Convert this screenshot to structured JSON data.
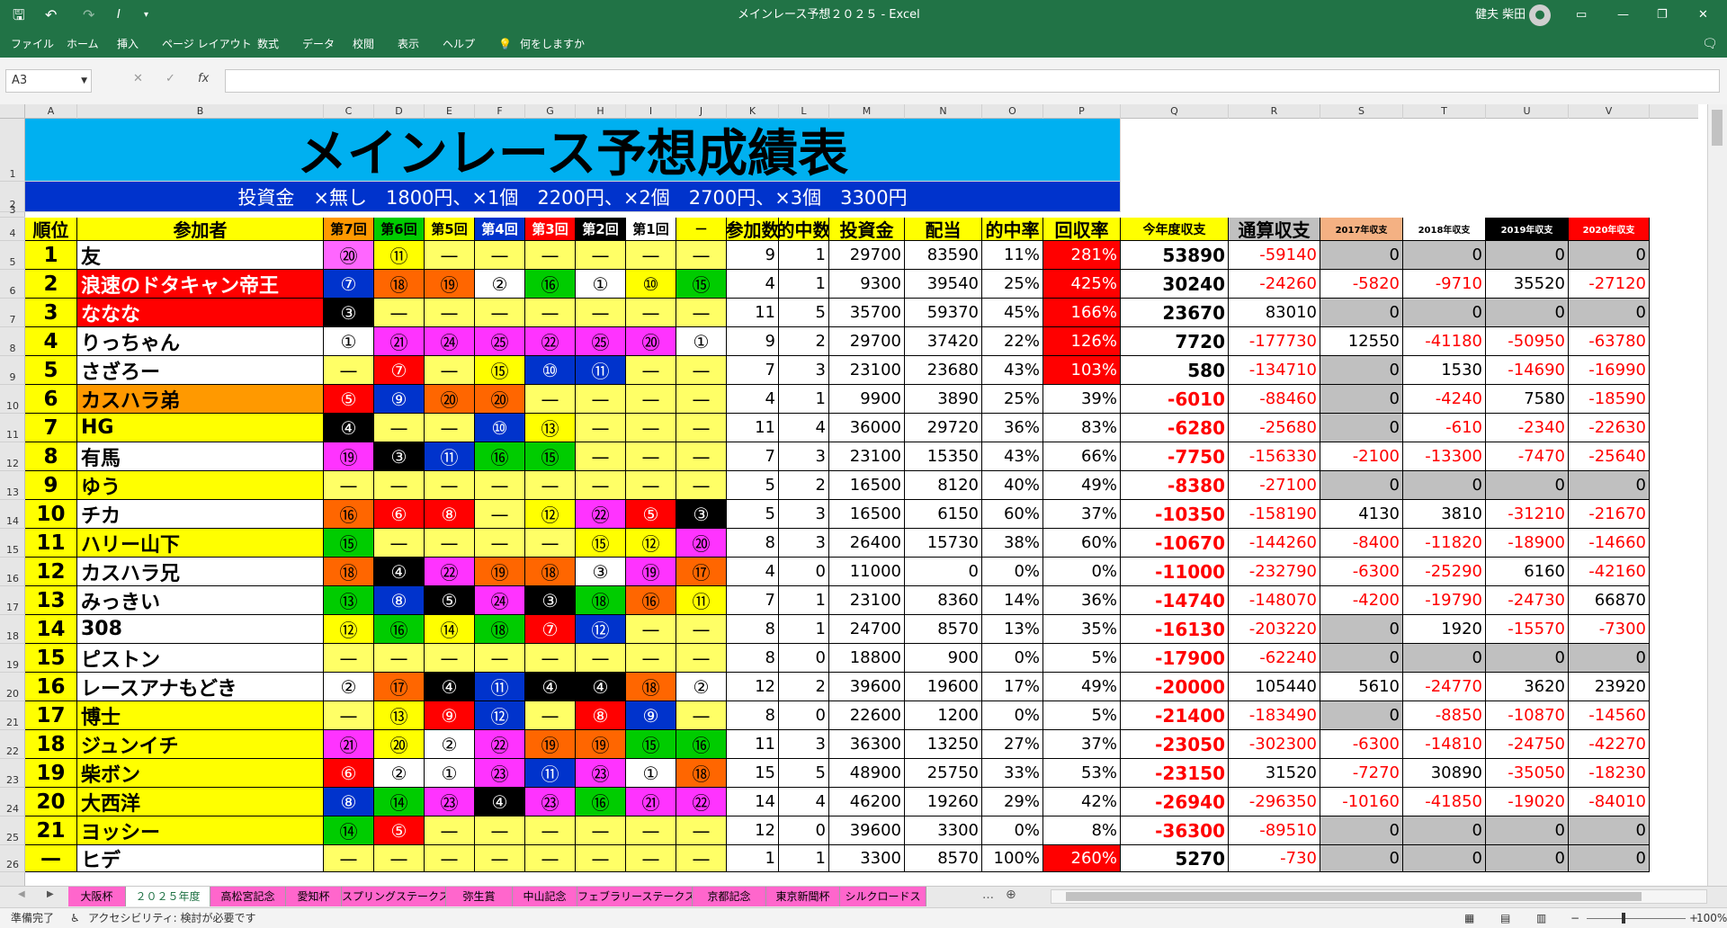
{
  "window": {
    "title": "メインレース予想２０２５ - Excel",
    "user": "健夫 柴田"
  },
  "ribbon": {
    "tabs": [
      "ファイル",
      "ホーム",
      "挿入",
      "ページ レイアウト",
      "数式",
      "データ",
      "校閲",
      "表示",
      "ヘルプ"
    ],
    "tell_me": "何をしますか"
  },
  "formula": {
    "cell_ref": "A3",
    "fx": "fx",
    "value": ""
  },
  "columns": [
    "A",
    "B",
    "C",
    "D",
    "E",
    "F",
    "G",
    "H",
    "I",
    "J",
    "K",
    "L",
    "M",
    "N",
    "O",
    "P",
    "Q",
    "R",
    "S",
    "T",
    "U",
    "V"
  ],
  "row_numbers": [
    "1",
    "2",
    "3",
    "4",
    "5",
    "6",
    "7",
    "8",
    "9",
    "10",
    "11",
    "12",
    "13",
    "14",
    "15",
    "16",
    "17",
    "18",
    "19",
    "20",
    "21",
    "22",
    "23",
    "24",
    "25",
    "26"
  ],
  "sheet": {
    "title": "メインレース予想成績表",
    "subtitle": "投資金　×無し　1800円、×1個　2200円、×2個　2700円、×3個　3300円",
    "headers": [
      "順位",
      "参加者",
      "第7回",
      "第6回",
      "第5回",
      "第4回",
      "第3回",
      "第2回",
      "第1回",
      "－",
      "参加数",
      "的中数",
      "投資金",
      "配当",
      "的中率",
      "回収率",
      "今年度収支",
      "通算収支",
      "2017年収支",
      "2018年収支",
      "2019年収支",
      "2020年収支"
    ],
    "rows": [
      {
        "rank": "1",
        "name": "友",
        "picks": [
          "⑳",
          "⑪",
          "—",
          "—",
          "—",
          "—",
          "—",
          "—"
        ],
        "count": "9",
        "hits": "1",
        "invest": "29700",
        "payout": "83590",
        "hit_rate": "11%",
        "return_rate": "281%",
        "year": "53890",
        "total": "-59140",
        "y2017": "0",
        "y2018": "0",
        "y2019": "0",
        "y2020": "0"
      },
      {
        "rank": "2",
        "name": "浪速のドタキャン帝王",
        "picks": [
          "⑦",
          "⑱",
          "⑲",
          "②",
          "⑯",
          "①",
          "⑩",
          "⑮"
        ],
        "count": "4",
        "hits": "1",
        "invest": "9300",
        "payout": "39540",
        "hit_rate": "25%",
        "return_rate": "425%",
        "year": "30240",
        "total": "-24260",
        "y2017": "-5820",
        "y2018": "-9710",
        "y2019": "35520",
        "y2020": "-27120"
      },
      {
        "rank": "3",
        "name": "ななな",
        "picks": [
          "③",
          "—",
          "—",
          "—",
          "—",
          "—",
          "—",
          "—"
        ],
        "count": "11",
        "hits": "5",
        "invest": "35700",
        "payout": "59370",
        "hit_rate": "45%",
        "return_rate": "166%",
        "year": "23670",
        "total": "83010",
        "y2017": "0",
        "y2018": "0",
        "y2019": "0",
        "y2020": "0"
      },
      {
        "rank": "4",
        "name": "りっちゃん",
        "picks": [
          "①",
          "㉑",
          "㉔",
          "㉕",
          "㉒",
          "㉕",
          "⑳",
          "①"
        ],
        "count": "9",
        "hits": "2",
        "invest": "29700",
        "payout": "37420",
        "hit_rate": "22%",
        "return_rate": "126%",
        "year": "7720",
        "total": "-177730",
        "y2017": "12550",
        "y2018": "-41180",
        "y2019": "-50950",
        "y2020": "-63780"
      },
      {
        "rank": "5",
        "name": "さざろー",
        "picks": [
          "—",
          "⑦",
          "—",
          "⑮",
          "⑩",
          "⑪",
          "—",
          "—"
        ],
        "count": "7",
        "hits": "3",
        "invest": "23100",
        "payout": "23680",
        "hit_rate": "43%",
        "return_rate": "103%",
        "year": "580",
        "total": "-134710",
        "y2017": "0",
        "y2018": "1530",
        "y2019": "-14690",
        "y2020": "-16990"
      },
      {
        "rank": "6",
        "name": "カスハラ弟",
        "picks": [
          "⑤",
          "⑨",
          "⑳",
          "⑳",
          "—",
          "—",
          "—",
          "—"
        ],
        "count": "4",
        "hits": "1",
        "invest": "9900",
        "payout": "3890",
        "hit_rate": "25%",
        "return_rate": "39%",
        "year": "-6010",
        "total": "-88460",
        "y2017": "0",
        "y2018": "-4240",
        "y2019": "7580",
        "y2020": "-18590"
      },
      {
        "rank": "7",
        "name": "HG",
        "picks": [
          "④",
          "—",
          "—",
          "⑩",
          "⑬",
          "—",
          "—",
          "—"
        ],
        "count": "11",
        "hits": "4",
        "invest": "36000",
        "payout": "29720",
        "hit_rate": "36%",
        "return_rate": "83%",
        "year": "-6280",
        "total": "-25680",
        "y2017": "0",
        "y2018": "-610",
        "y2019": "-2340",
        "y2020": "-22630"
      },
      {
        "rank": "8",
        "name": "有馬",
        "picks": [
          "⑲",
          "③",
          "⑪",
          "⑯",
          "⑮",
          "—",
          "—",
          "—"
        ],
        "count": "7",
        "hits": "3",
        "invest": "23100",
        "payout": "15350",
        "hit_rate": "43%",
        "return_rate": "66%",
        "year": "-7750",
        "total": "-156330",
        "y2017": "-2100",
        "y2018": "-13300",
        "y2019": "-7470",
        "y2020": "-25640"
      },
      {
        "rank": "9",
        "name": "ゆう",
        "picks": [
          "—",
          "—",
          "—",
          "—",
          "—",
          "—",
          "—",
          "—"
        ],
        "count": "5",
        "hits": "2",
        "invest": "16500",
        "payout": "8120",
        "hit_rate": "40%",
        "return_rate": "49%",
        "year": "-8380",
        "total": "-27100",
        "y2017": "0",
        "y2018": "0",
        "y2019": "0",
        "y2020": "0"
      },
      {
        "rank": "10",
        "name": "チカ",
        "picks": [
          "⑯",
          "⑥",
          "⑧",
          "—",
          "⑫",
          "㉒",
          "⑤",
          "③"
        ],
        "count": "5",
        "hits": "3",
        "invest": "16500",
        "payout": "6150",
        "hit_rate": "60%",
        "return_rate": "37%",
        "year": "-10350",
        "total": "-158190",
        "y2017": "4130",
        "y2018": "3810",
        "y2019": "-31210",
        "y2020": "-21670"
      },
      {
        "rank": "11",
        "name": "ハリー山下",
        "picks": [
          "⑮",
          "—",
          "—",
          "—",
          "—",
          "⑮",
          "⑫",
          "⑳"
        ],
        "count": "8",
        "hits": "3",
        "invest": "26400",
        "payout": "15730",
        "hit_rate": "38%",
        "return_rate": "60%",
        "year": "-10670",
        "total": "-144260",
        "y2017": "-8400",
        "y2018": "-11820",
        "y2019": "-18900",
        "y2020": "-14660"
      },
      {
        "rank": "12",
        "name": "カスハラ兄",
        "picks": [
          "⑱",
          "④",
          "㉒",
          "⑲",
          "⑱",
          "③",
          "⑲",
          "⑰"
        ],
        "count": "4",
        "hits": "0",
        "invest": "11000",
        "payout": "0",
        "hit_rate": "0%",
        "return_rate": "0%",
        "year": "-11000",
        "total": "-232790",
        "y2017": "-6300",
        "y2018": "-25290",
        "y2019": "6160",
        "y2020": "-42160"
      },
      {
        "rank": "13",
        "name": "みっきい",
        "picks": [
          "⑬",
          "⑧",
          "⑤",
          "㉔",
          "③",
          "⑱",
          "⑯",
          "⑪"
        ],
        "count": "7",
        "hits": "1",
        "invest": "23100",
        "payout": "8360",
        "hit_rate": "14%",
        "return_rate": "36%",
        "year": "-14740",
        "total": "-148070",
        "y2017": "-4200",
        "y2018": "-19790",
        "y2019": "-24730",
        "y2020": "66870"
      },
      {
        "rank": "14",
        "name": "308",
        "picks": [
          "⑫",
          "⑯",
          "⑭",
          "⑱",
          "⑦",
          "⑫",
          "—",
          "—"
        ],
        "count": "8",
        "hits": "1",
        "invest": "24700",
        "payout": "8570",
        "hit_rate": "13%",
        "return_rate": "35%",
        "year": "-16130",
        "total": "-203220",
        "y2017": "0",
        "y2018": "1920",
        "y2019": "-15570",
        "y2020": "-7300"
      },
      {
        "rank": "15",
        "name": "ピストン",
        "picks": [
          "—",
          "—",
          "—",
          "—",
          "—",
          "—",
          "—",
          "—"
        ],
        "count": "8",
        "hits": "0",
        "invest": "18800",
        "payout": "900",
        "hit_rate": "0%",
        "return_rate": "5%",
        "year": "-17900",
        "total": "-62240",
        "y2017": "0",
        "y2018": "0",
        "y2019": "0",
        "y2020": "0"
      },
      {
        "rank": "16",
        "name": "レースアナもどき",
        "picks": [
          "②",
          "⑰",
          "④",
          "⑪",
          "④",
          "④",
          "⑱",
          "②"
        ],
        "count": "12",
        "hits": "2",
        "invest": "39600",
        "payout": "19600",
        "hit_rate": "17%",
        "return_rate": "49%",
        "year": "-20000",
        "total": "105440",
        "y2017": "5610",
        "y2018": "-24770",
        "y2019": "3620",
        "y2020": "23920"
      },
      {
        "rank": "17",
        "name": "博士",
        "picks": [
          "—",
          "⑬",
          "⑨",
          "⑫",
          "—",
          "⑧",
          "⑨",
          "—"
        ],
        "count": "8",
        "hits": "0",
        "invest": "22600",
        "payout": "1200",
        "hit_rate": "0%",
        "return_rate": "5%",
        "year": "-21400",
        "total": "-183490",
        "y2017": "0",
        "y2018": "-8850",
        "y2019": "-10870",
        "y2020": "-14560"
      },
      {
        "rank": "18",
        "name": "ジュンイチ",
        "picks": [
          "㉑",
          "⑳",
          "②",
          "㉒",
          "⑲",
          "⑲",
          "⑮",
          "⑯"
        ],
        "count": "11",
        "hits": "3",
        "invest": "36300",
        "payout": "13250",
        "hit_rate": "27%",
        "return_rate": "37%",
        "year": "-23050",
        "total": "-302300",
        "y2017": "-6300",
        "y2018": "-14810",
        "y2019": "-24750",
        "y2020": "-42270"
      },
      {
        "rank": "19",
        "name": "柴ボン",
        "picks": [
          "⑥",
          "②",
          "①",
          "㉓",
          "⑪",
          "㉓",
          "①",
          "⑱"
        ],
        "count": "15",
        "hits": "5",
        "invest": "48900",
        "payout": "25750",
        "hit_rate": "33%",
        "return_rate": "53%",
        "year": "-23150",
        "total": "31520",
        "y2017": "-7270",
        "y2018": "30890",
        "y2019": "-35050",
        "y2020": "-18230"
      },
      {
        "rank": "20",
        "name": "大西洋",
        "picks": [
          "⑧",
          "⑭",
          "㉓",
          "④",
          "㉓",
          "⑯",
          "㉑",
          "㉒"
        ],
        "count": "14",
        "hits": "4",
        "invest": "46200",
        "payout": "19260",
        "hit_rate": "29%",
        "return_rate": "42%",
        "year": "-26940",
        "total": "-296350",
        "y2017": "-10160",
        "y2018": "-41850",
        "y2019": "-19020",
        "y2020": "-84010"
      },
      {
        "rank": "21",
        "name": "ヨッシー",
        "picks": [
          "⑭",
          "⑤",
          "—",
          "—",
          "—",
          "—",
          "—",
          "—"
        ],
        "count": "12",
        "hits": "0",
        "invest": "39600",
        "payout": "3300",
        "hit_rate": "0%",
        "return_rate": "8%",
        "year": "-36300",
        "total": "-89510",
        "y2017": "0",
        "y2018": "0",
        "y2019": "0",
        "y2020": "0"
      },
      {
        "rank": "—",
        "name": "ヒデ",
        "picks": [
          "—",
          "—",
          "—",
          "—",
          "—",
          "—",
          "—",
          "—"
        ],
        "count": "1",
        "hits": "1",
        "invest": "3300",
        "payout": "8570",
        "hit_rate": "100%",
        "return_rate": "260%",
        "year": "5270",
        "total": "-730",
        "y2017": "0",
        "y2018": "0",
        "y2019": "0",
        "y2020": "0"
      }
    ]
  },
  "colors": {
    "excel_green": "#217346",
    "title_bg": "#00b0f0",
    "title_text": "#000000",
    "subtitle_bg": "#0033cc",
    "subtitle_text": "#ffffff",
    "header_bg": "#ffff00",
    "name_red": "#ff0000",
    "name_orange": "#ff9900",
    "ret_red": "#ff0000",
    "neg_red": "#ff0000",
    "gray": "#c0c0c0"
  },
  "pick_colors": [
    [
      "#ff66ff",
      "#ffff00",
      "#ffff66",
      "#ffff66",
      "#ffff66",
      "#ffff66",
      "#ffff66",
      "#ffff66"
    ],
    [
      "#0033cc",
      "#ff6600",
      "#ff6600",
      "#ffffff",
      "#00cc00",
      "#ffffff",
      "#ffff00",
      "#00cc00"
    ],
    [
      "#000000",
      "#ffff66",
      "#ffff66",
      "#ffff66",
      "#ffff66",
      "#ffff66",
      "#ffff66",
      "#ffff66"
    ],
    [
      "#ffffff",
      "#ff33ff",
      "#ff33ff",
      "#ff33ff",
      "#ff33ff",
      "#ff33ff",
      "#ff33ff",
      "#ffffff"
    ],
    [
      "#ffff66",
      "#ff0000",
      "#ffff66",
      "#ffff00",
      "#0033cc",
      "#0033cc",
      "#ffff66",
      "#ffff66"
    ],
    [
      "#ff0000",
      "#0033cc",
      "#ff6600",
      "#ff6600",
      "#ffff66",
      "#ffff66",
      "#ffff66",
      "#ffff66"
    ],
    [
      "#000000",
      "#ffff66",
      "#ffff66",
      "#0033cc",
      "#ffff00",
      "#ffff66",
      "#ffff66",
      "#ffff66"
    ],
    [
      "#ff33ff",
      "#000000",
      "#0033cc",
      "#00cc00",
      "#00cc00",
      "#ffff66",
      "#ffff66",
      "#ffff66"
    ],
    [
      "#ffff66",
      "#ffff66",
      "#ffff66",
      "#ffff66",
      "#ffff66",
      "#ffff66",
      "#ffff66",
      "#ffff66"
    ],
    [
      "#ff6600",
      "#ff0000",
      "#ff0000",
      "#ffff66",
      "#ffff00",
      "#ff33ff",
      "#ff0000",
      "#000000"
    ],
    [
      "#00cc00",
      "#ffff66",
      "#ffff66",
      "#ffff66",
      "#ffff66",
      "#ffff00",
      "#ffff00",
      "#ff33ff"
    ],
    [
      "#ff6600",
      "#000000",
      "#ff33ff",
      "#ff6600",
      "#ff6600",
      "#ffffff",
      "#ff33ff",
      "#ff6600"
    ],
    [
      "#00cc00",
      "#0033cc",
      "#000000",
      "#ff33ff",
      "#000000",
      "#00cc00",
      "#ff6600",
      "#ffff00"
    ],
    [
      "#ffff00",
      "#00cc00",
      "#ffff00",
      "#00cc00",
      "#ff0000",
      "#0033cc",
      "#ffff66",
      "#ffff66"
    ],
    [
      "#ffff66",
      "#ffff66",
      "#ffff66",
      "#ffff66",
      "#ffff66",
      "#ffff66",
      "#ffff66",
      "#ffff66"
    ],
    [
      "#ffffff",
      "#ff6600",
      "#000000",
      "#0033cc",
      "#000000",
      "#000000",
      "#ff6600",
      "#ffffff"
    ],
    [
      "#ffff66",
      "#ffff00",
      "#ff0000",
      "#0033cc",
      "#ffff66",
      "#ff0000",
      "#0033cc",
      "#ffff66"
    ],
    [
      "#ff33ff",
      "#ffff00",
      "#ffffff",
      "#ff33ff",
      "#ff6600",
      "#ff6600",
      "#00cc00",
      "#00cc00"
    ],
    [
      "#ff0000",
      "#ffffff",
      "#ffffff",
      "#ff33ff",
      "#0033cc",
      "#ff33ff",
      "#ffffff",
      "#ff6600"
    ],
    [
      "#0033cc",
      "#00cc00",
      "#ff33ff",
      "#000000",
      "#ff33ff",
      "#00cc00",
      "#ff33ff",
      "#ff33ff"
    ],
    [
      "#00cc00",
      "#ff0000",
      "#ffff66",
      "#ffff66",
      "#ffff66",
      "#ffff66",
      "#ffff66",
      "#ffff66"
    ],
    [
      "#ffff66",
      "#ffff66",
      "#ffff66",
      "#ffff66",
      "#ffff66",
      "#ffff66",
      "#ffff66",
      "#ffff66"
    ]
  ],
  "header_colors": [
    [
      "#ff9900",
      "#000"
    ],
    [
      "#00cc00",
      "#000"
    ],
    [
      "#ffff00",
      "#000"
    ],
    [
      "#0033cc",
      "#fff"
    ],
    [
      "#ff0000",
      "#fff"
    ],
    [
      "#000000",
      "#fff"
    ],
    [
      "#ffffff",
      "#000"
    ],
    [
      "#ffff00",
      "#000"
    ]
  ],
  "year_header_colors": [
    [
      "#f4b183",
      "#000"
    ],
    [
      "#ffffff",
      "#000"
    ],
    [
      "#000000",
      "#fff"
    ],
    [
      "#ff0000",
      "#fff"
    ]
  ],
  "name_bg": [
    "#ffffff",
    "#ff0000",
    "#ff0000",
    "#ffffff",
    "#ffffff",
    "#ff9900",
    "#ffff00",
    "#ffffff",
    "#ffff00",
    "#ffffff",
    "#ffff00",
    "#ffffff",
    "#ffffff",
    "#ffffff",
    "#ffffff",
    "#ffffff",
    "#ffff00",
    "#ffff00",
    "#ffff00",
    "#ffff00",
    "#ffff00",
    "#ffffff"
  ],
  "tabs": [
    "大阪杯",
    "２０２５年度",
    "高松宮記念",
    "愛知杯",
    "スプリングステークス",
    "弥生賞",
    "中山記念",
    "フェブラリーステークス",
    "京都記念",
    "東京新聞杯",
    "シルクロードス"
  ],
  "active_tab": 1,
  "status": {
    "ready": "準備完了",
    "accessibility": "アクセシビリティ: 検討が必要です",
    "zoom": "100%"
  }
}
